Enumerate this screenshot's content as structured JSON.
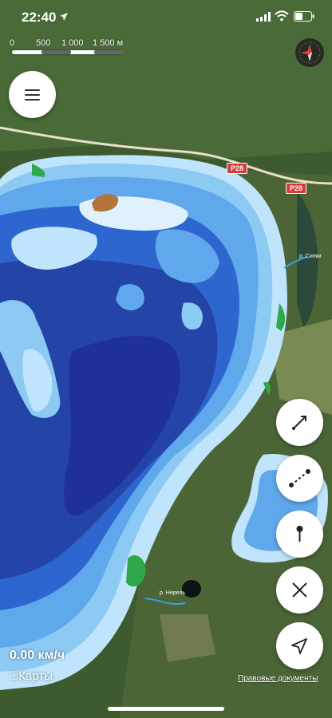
{
  "status": {
    "time": "22:40"
  },
  "scale": {
    "labels": [
      "0",
      "500",
      "1 000",
      "1 500 м"
    ]
  },
  "roads": {
    "label_1": "P28",
    "label_2": "P28"
  },
  "places": {
    "label_river": "р. Сипки",
    "label_small": "р. Нерель"
  },
  "speed": {
    "text": "0.00 км/ч"
  },
  "brand": {
    "text": "Карты"
  },
  "legal": {
    "text": "Правовые документы"
  },
  "icons": {
    "menu": "menu-icon",
    "compass": "compass-icon",
    "b1": "line-arrow-icon",
    "b2": "route-dots-icon",
    "b3": "pin-icon",
    "b4": "close-icon",
    "b5": "location-arrow-icon"
  },
  "colors": {
    "deep": "#1f3196",
    "mid": "#2e66d0",
    "light": "#5fa8ec",
    "shore": "#bfe4fb",
    "land": "#3e5a2f"
  }
}
